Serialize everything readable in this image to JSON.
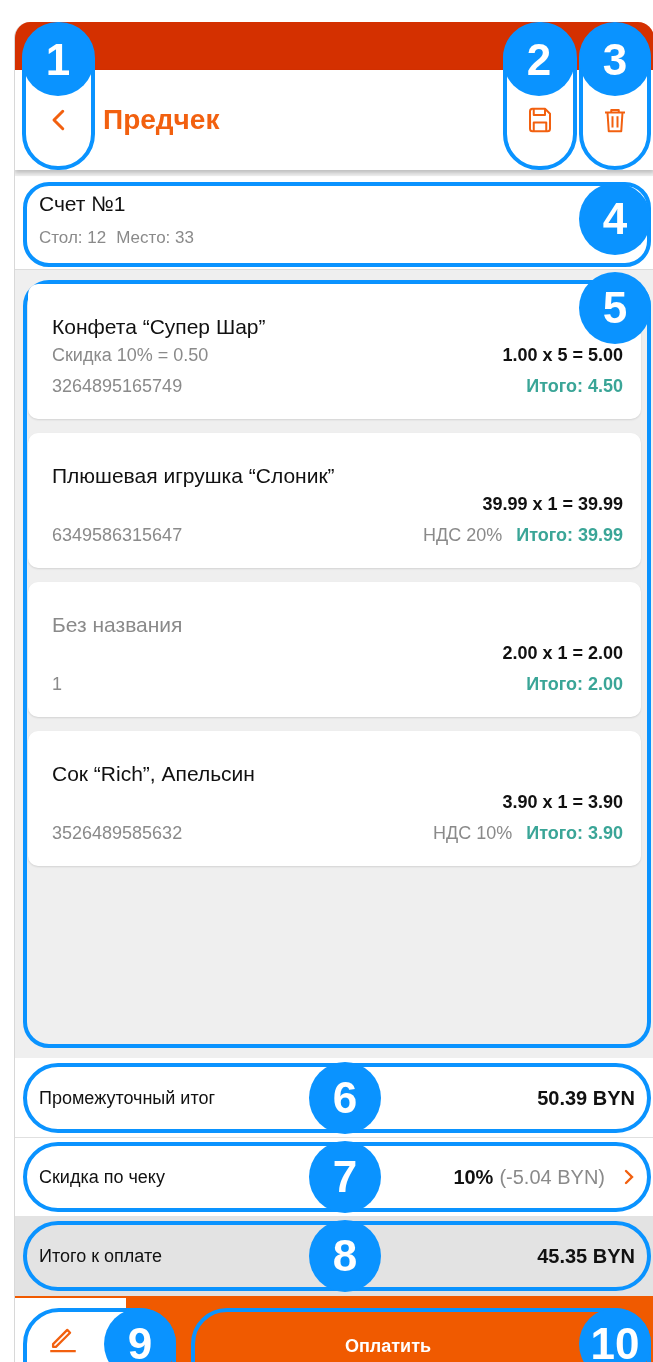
{
  "header": {
    "back_button": {
      "callout": "1"
    },
    "title": "Предчек",
    "actions": [
      {
        "kind": "save",
        "callout": "2"
      },
      {
        "kind": "delete",
        "callout": "3"
      }
    ]
  },
  "account": {
    "title": "Счет №1",
    "table": "Стол: 12",
    "seat": "Место: 33",
    "callout": "4"
  },
  "items": {
    "callout": "5",
    "rows": [
      {
        "name": "Конфета “Супер Шар”",
        "muted": false,
        "discount": "Скидка 10% = 0.50",
        "calc": "1.00 x 5 = 5.00",
        "code": "3264895165749",
        "total": "Итого: 4.50"
      },
      {
        "name": "Плюшевая игрушка “Слоник”",
        "muted": false,
        "calc": "39.99 x 1 = 39.99",
        "code": "6349586315647",
        "vat": "НДС 20%",
        "total": "Итого: 39.99"
      },
      {
        "name": "Без названия",
        "muted": true,
        "calc": "2.00 x 1 = 2.00",
        "code": "1",
        "total": "Итого: 2.00"
      },
      {
        "name": "Сок “Rich”, Апельсин",
        "muted": false,
        "calc": "3.90 x 1 = 3.90",
        "code": "3526489585632",
        "vat": "НДС 10%",
        "total": "Итого: 3.90"
      }
    ]
  },
  "summary": [
    {
      "kind": "subtotal",
      "label": "Промежуточный итог",
      "value": "50.39 BYN",
      "callout": "6"
    },
    {
      "kind": "discount",
      "label": "Скидка по чеку",
      "value": "10%",
      "detail": "(-5.04 BYN)",
      "callout": "7"
    },
    {
      "kind": "total",
      "label": "Итого к оплате",
      "value": "45.35 BYN",
      "callout": "8"
    }
  ],
  "footer": {
    "edit_button": {
      "callout": "9"
    },
    "pay_button": {
      "label": "Оплатить",
      "callout": "10"
    }
  }
}
